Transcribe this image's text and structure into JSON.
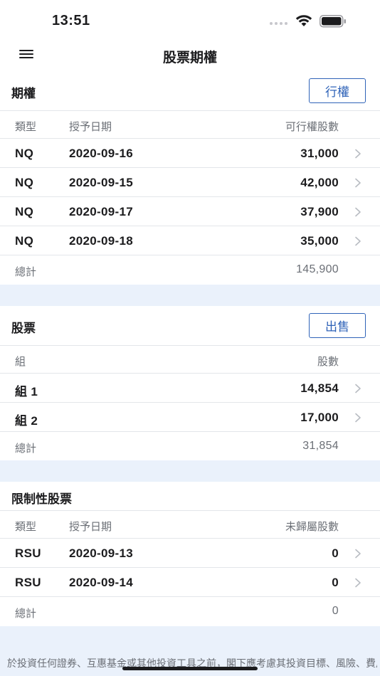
{
  "status": {
    "time": "13:51"
  },
  "nav": {
    "title": "股票期權"
  },
  "options": {
    "title": "期權",
    "button": "行權",
    "headers": {
      "type": "類型",
      "date": "授予日期",
      "qty": "可行權股數"
    },
    "rows": [
      {
        "type": "NQ",
        "date": "2020-09-16",
        "qty": "31,000"
      },
      {
        "type": "NQ",
        "date": "2020-09-15",
        "qty": "42,000"
      },
      {
        "type": "NQ",
        "date": "2020-09-17",
        "qty": "37,900"
      },
      {
        "type": "NQ",
        "date": "2020-09-18",
        "qty": "35,000"
      }
    ],
    "total_label": "總計",
    "total": "145,900"
  },
  "stocks": {
    "title": "股票",
    "button": "出售",
    "headers": {
      "group": "組",
      "qty": "股數"
    },
    "rows": [
      {
        "group": "組 1",
        "qty": "14,854"
      },
      {
        "group": "組 2",
        "qty": "17,000"
      }
    ],
    "total_label": "總計",
    "total": "31,854"
  },
  "restricted": {
    "title": "限制性股票",
    "headers": {
      "type": "類型",
      "date": "授予日期",
      "qty": "未歸屬股數"
    },
    "rows": [
      {
        "type": "RSU",
        "date": "2020-09-13",
        "qty": "0"
      },
      {
        "type": "RSU",
        "date": "2020-09-14",
        "qty": "0"
      }
    ],
    "total_label": "總計",
    "total": "0"
  },
  "disclaimer": "於投資任何證券、互惠基金或其他投資工具之前，閣下應考慮其投資目標、風險、費用和支出。請與核聚證券有限公司聯繫以獲取載有此資料的招股",
  "icons": {
    "menu": "hamburger-menu-icon",
    "chevron": "chevron-right-icon",
    "wifi": "wifi-icon",
    "battery": "battery-icon",
    "signal": "cellular-signal-icon"
  },
  "colors": {
    "accent": "#2f63b8",
    "section_gap": "#eaf1fb",
    "muted": "#6b6f76"
  }
}
